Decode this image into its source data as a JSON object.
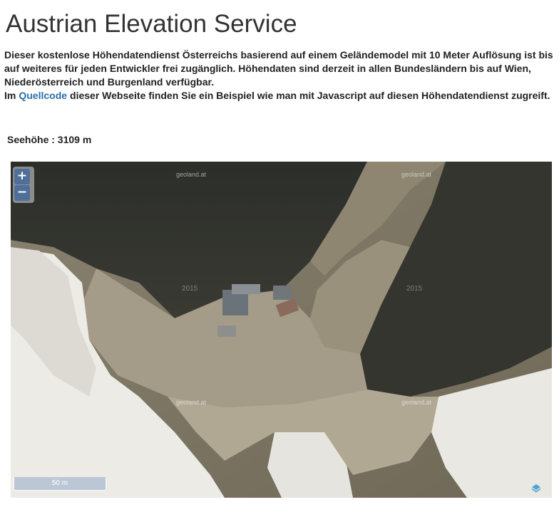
{
  "page": {
    "title": "Austrian Elevation Service"
  },
  "intro": {
    "text1": "Dieser kostenlose Höhendatendienst Österreichs basierend auf einem Geländemodel mit 10 Meter Auflösung ist bis auf weiteres für jeden Entwickler frei zugänglich. Höhendaten sind derzeit in allen Bundesländern bis auf Wien, Niederösterreich und Burgenland verfügbar.",
    "prefix": "Im",
    "link": "Quellcode",
    "suffix": "dieser Webseite finden Sie ein Beispiel wie man mit Javascript auf diesen Höhendatendienst zugreift."
  },
  "elevation": {
    "label": "Seehöhe : 3109 m"
  },
  "map": {
    "zoom_in": "+",
    "zoom_out": "−",
    "scale": "50 m",
    "watermark": "geoland.at",
    "year": "2015",
    "icons": [
      "plus-icon",
      "minus-icon",
      "layers-icon"
    ]
  }
}
